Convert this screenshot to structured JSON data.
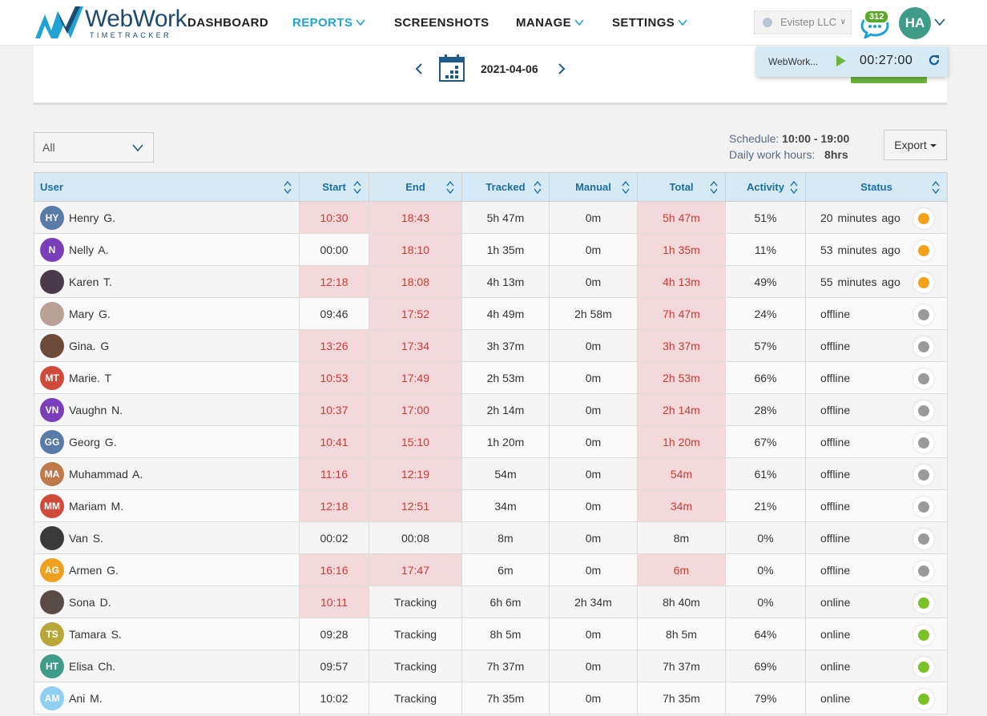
{
  "logo": {
    "brand": "WebWork",
    "sub": "TIMETRACKER"
  },
  "nav": [
    {
      "label": "DASHBOARD",
      "dropdown": false,
      "active": false
    },
    {
      "label": "REPORTS",
      "dropdown": true,
      "active": true
    },
    {
      "label": "SCREENSHOTS",
      "dropdown": false,
      "active": false
    },
    {
      "label": "MANAGE",
      "dropdown": true,
      "active": false
    },
    {
      "label": "SETTINGS",
      "dropdown": true,
      "active": false
    }
  ],
  "company": "Evistep LLC",
  "chat_badge": "312",
  "user_initials": "HA",
  "date": "2021-04-06",
  "timer": {
    "project": "WebWork...",
    "time": "00:27:00"
  },
  "filter": {
    "value": "All"
  },
  "schedule": {
    "label": "Schedule:",
    "value": "10:00 - 19:00",
    "hours_label": "Daily work hours:",
    "hours_value": "8hrs"
  },
  "export_label": "Export",
  "columns": [
    "User",
    "Start",
    "End",
    "Tracked",
    "Manual",
    "Total",
    "Activity",
    "Status"
  ],
  "colors": {
    "late_bg": "#f3d9d9",
    "late_text": "#c83a3a",
    "orange": "#f5a11b",
    "gray": "#9a9a9a",
    "green": "#7cc02a",
    "header_bg": "#d6eaf6"
  },
  "rows": [
    {
      "initials": "HY",
      "avatar_color": "#5a7aa8",
      "name": "Henry G.",
      "start": "10:30",
      "start_late": true,
      "end": "18:43",
      "end_late": true,
      "tracked": "5h 47m",
      "manual": "0m",
      "total": "5h 47m",
      "total_late": true,
      "activity": "51%",
      "status": "20 minutes ago",
      "state": "orange"
    },
    {
      "initials": "N",
      "avatar_color": "#7a3fb8",
      "name": "Nelly A.",
      "start": "00:00",
      "start_late": false,
      "end": "18:10",
      "end_late": true,
      "tracked": "1h 35m",
      "manual": "0m",
      "total": "1h 35m",
      "total_late": true,
      "activity": "11%",
      "status": "53 minutes ago",
      "state": "orange"
    },
    {
      "initials": "",
      "avatar_color": "#4a3a4a",
      "name": "Karen T.",
      "start": "12:18",
      "start_late": true,
      "end": "18:08",
      "end_late": true,
      "tracked": "4h 13m",
      "manual": "0m",
      "total": "4h 13m",
      "total_late": true,
      "activity": "49%",
      "status": "55 minutes ago",
      "state": "orange"
    },
    {
      "initials": "",
      "avatar_color": "#b9a196",
      "name": "Mary G.",
      "start": "09:46",
      "start_late": false,
      "end": "17:52",
      "end_late": true,
      "tracked": "4h 49m",
      "manual": "2h 58m",
      "total": "7h 47m",
      "total_late": true,
      "activity": "24%",
      "status": "offline",
      "state": "gray"
    },
    {
      "initials": "",
      "avatar_color": "#6b4a3a",
      "name": "Gina. G",
      "start": "13:26",
      "start_late": true,
      "end": "17:34",
      "end_late": true,
      "tracked": "3h 37m",
      "manual": "0m",
      "total": "3h 37m",
      "total_late": true,
      "activity": "57%",
      "status": "offline",
      "state": "gray"
    },
    {
      "initials": "MT",
      "avatar_color": "#d04a3a",
      "name": "Marie. T",
      "start": "10:53",
      "start_late": true,
      "end": "17:49",
      "end_late": true,
      "tracked": "2h 53m",
      "manual": "0m",
      "total": "2h 53m",
      "total_late": true,
      "activity": "66%",
      "status": "offline",
      "state": "gray"
    },
    {
      "initials": "VN",
      "avatar_color": "#7a3fb8",
      "name": "Vaughn N.",
      "start": "10:37",
      "start_late": true,
      "end": "17:00",
      "end_late": true,
      "tracked": "2h 14m",
      "manual": "0m",
      "total": "2h 14m",
      "total_late": true,
      "activity": "28%",
      "status": "offline",
      "state": "gray"
    },
    {
      "initials": "GG",
      "avatar_color": "#5a7aa8",
      "name": "Georg G.",
      "start": "10:41",
      "start_late": true,
      "end": "15:10",
      "end_late": true,
      "tracked": "1h 20m",
      "manual": "0m",
      "total": "1h 20m",
      "total_late": true,
      "activity": "67%",
      "status": "offline",
      "state": "gray"
    },
    {
      "initials": "MA",
      "avatar_color": "#c07a4a",
      "name": "Muhammad A.",
      "start": "11:16",
      "start_late": true,
      "end": "12:19",
      "end_late": true,
      "tracked": "54m",
      "manual": "0m",
      "total": "54m",
      "total_late": true,
      "activity": "61%",
      "status": "offline",
      "state": "gray"
    },
    {
      "initials": "MM",
      "avatar_color": "#d04a3a",
      "name": "Mariam M.",
      "start": "12:18",
      "start_late": true,
      "end": "12:51",
      "end_late": true,
      "tracked": "34m",
      "manual": "0m",
      "total": "34m",
      "total_late": true,
      "activity": "21%",
      "status": "offline",
      "state": "gray"
    },
    {
      "initials": "",
      "avatar_color": "#3a3a3a",
      "name": "Van S.",
      "start": "00:02",
      "start_late": false,
      "end": "00:08",
      "end_late": false,
      "tracked": "8m",
      "manual": "0m",
      "total": "8m",
      "total_late": false,
      "activity": "0%",
      "status": "offline",
      "state": "gray"
    },
    {
      "initials": "AG",
      "avatar_color": "#f0a020",
      "name": "Armen G.",
      "start": "16:16",
      "start_late": true,
      "end": "17:47",
      "end_late": true,
      "tracked": "6m",
      "manual": "0m",
      "total": "6m",
      "total_late": true,
      "activity": "0%",
      "status": "offline",
      "state": "gray"
    },
    {
      "initials": "",
      "avatar_color": "#5a4a48",
      "name": "Sona D.",
      "start": "10:11",
      "start_late": true,
      "end": "Tracking",
      "end_late": false,
      "tracked": "6h 6m",
      "manual": "2h 34m",
      "total": "8h 40m",
      "total_late": false,
      "activity": "0%",
      "status": "online",
      "state": "green"
    },
    {
      "initials": "TS",
      "avatar_color": "#b8a83a",
      "name": "Tamara S.",
      "start": "09:28",
      "start_late": false,
      "end": "Tracking",
      "end_late": false,
      "tracked": "8h 5m",
      "manual": "0m",
      "total": "8h 5m",
      "total_late": false,
      "activity": "64%",
      "status": "online",
      "state": "green"
    },
    {
      "initials": "HT",
      "avatar_color": "#3f9c89",
      "name": "Elisa Ch.",
      "start": "09:57",
      "start_late": false,
      "end": "Tracking",
      "end_late": false,
      "tracked": "7h 37m",
      "manual": "0m",
      "total": "7h 37m",
      "total_late": false,
      "activity": "69%",
      "status": "online",
      "state": "green"
    },
    {
      "initials": "AM",
      "avatar_color": "#8fcff0",
      "name": "Ani M.",
      "start": "10:02",
      "start_late": false,
      "end": "Tracking",
      "end_late": false,
      "tracked": "7h 35m",
      "manual": "0m",
      "total": "7h 35m",
      "total_late": false,
      "activity": "79%",
      "status": "online",
      "state": "green"
    }
  ]
}
